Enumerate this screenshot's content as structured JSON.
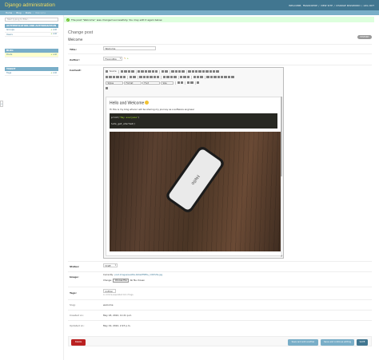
{
  "header": {
    "brand": "Django administration",
    "user_tools": [
      "WELCOME,",
      "FRANCOPOP",
      "/",
      "VIEW SITE",
      "/",
      "CHANGE PASSWORD",
      "/",
      "LOG OUT"
    ]
  },
  "breadcrumbs": {
    "home": "Home",
    "sep": "›",
    "app": "Blog",
    "model": "Posts",
    "current": "Welcome"
  },
  "sidebar": {
    "filter_placeholder": "Start typing to filter…",
    "collapse_glyph": "«",
    "modules": [
      {
        "caption": "AUTHENTICATION AND AUTHORIZATION",
        "items": [
          {
            "label": "Groups",
            "add": "Add"
          },
          {
            "label": "Users",
            "add": "Add"
          }
        ]
      },
      {
        "caption": "BLOG",
        "items": [
          {
            "label": "Posts",
            "add": "Add",
            "active": true
          }
        ]
      },
      {
        "caption": "TAGGIT",
        "items": [
          {
            "label": "Tags",
            "add": "Add"
          }
        ]
      }
    ]
  },
  "message": {
    "text": "The post “Welcome” was changed successfully. You may edit it again below."
  },
  "page": {
    "title": "Change post",
    "object_title": "Welcome",
    "history_label": "HISTORY"
  },
  "form": {
    "title_label": "Title:",
    "title_value": "Welcome",
    "author_label": "Author:",
    "author_value": "FrancoPop",
    "content_label": "Content:",
    "status_label": "Status:",
    "status_value": "Draft",
    "image_label": "Image:",
    "image_currently_label": "Currently:",
    "image_currently_value": "post-images/seattle-4b6e0ff9f0a_ro5DSHe.jpg",
    "image_change_label": "Change:",
    "image_choose_label": "Choose File",
    "image_no_file": "No file chosen",
    "tags_label": "Tags:",
    "tags_value": "python",
    "tags_help": "A comma-separated list of tags.",
    "slug_label": "Slug:",
    "slug_value": "welcome",
    "created_label": "Created on:",
    "created_value": "May 18, 2022, 11:21 p.m.",
    "updated_label": "Updated on:",
    "updated_value": "May 19, 2022, 2:23 p.m."
  },
  "editor": {
    "source_label": "Source",
    "styles_label": "Styles",
    "format_label": "Format",
    "font_label": "Font",
    "size_label": "Size",
    "heading": "Hello and Welcome",
    "paragraph": "Hi this is my blog where I will be sharing my journey as a software engineer",
    "code_line1_fn": "print(",
    "code_line1_str": "\"Hey everyone\"",
    "code_line1_end": ")",
    "code_line2": "lets_get_started()",
    "photo_text": "Hello"
  },
  "submit": {
    "delete_label": "Delete",
    "save_add_label": "Save and add another",
    "save_continue_label": "Save and continue editing",
    "save_label": "SAVE"
  }
}
